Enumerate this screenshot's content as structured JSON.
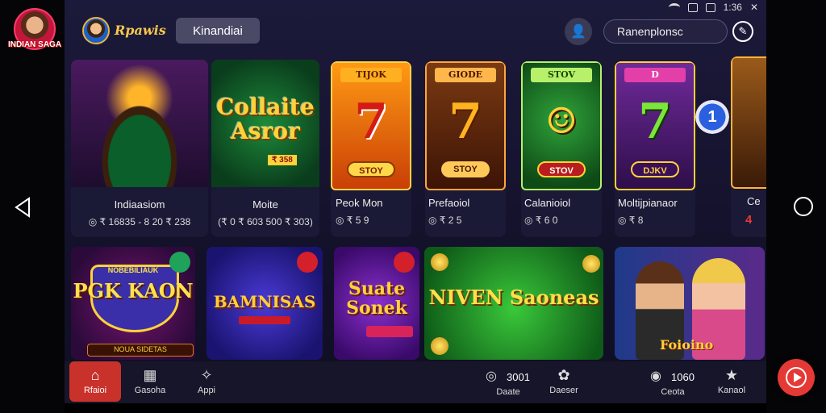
{
  "app": {
    "logo_caption": "INDIAN SAGA"
  },
  "status": {
    "time": "1:36"
  },
  "header": {
    "user_name": "Rpawis",
    "chip_label": "Kinandiai",
    "search_value": "Ranenplonsc"
  },
  "cards_row1": [
    {
      "title": "Indiaasiom",
      "meta": "◎ ₹ 16835 - 8 20 ₹ 238"
    },
    {
      "title": "Moite",
      "meta": "(₹ 0 ₹ 603 500 ₹ 303)",
      "logo": "Collaite Asror",
      "sub": "₹ 358"
    },
    {
      "title": "Peok Mon",
      "meta": "◎ ₹ 5 9",
      "tag": "TIJOK",
      "big": "7",
      "stop": "STOY"
    },
    {
      "title": "Prefaoiol",
      "meta": "◎ ₹ 2 5",
      "tag": "GIODE",
      "big": "7",
      "stop": "STOY"
    },
    {
      "title": "Calanioiol",
      "meta": "◎ ₹ 6 0",
      "tag": "STOV",
      "big": "☺",
      "stop": "STOV"
    },
    {
      "title": "Moltijpianaor",
      "meta": "◎ ₹ 8",
      "tag": "D",
      "big": "7",
      "stop": "DJKV"
    },
    {
      "title": "Ce",
      "meta": "4"
    }
  ],
  "badge_number": "1",
  "cards_row2": [
    {
      "logo_small": "NOBEBILIAUK",
      "logo": "PGK KAON",
      "bar": "NOUA SIDETAS"
    },
    {
      "logo": "BAMNISAS"
    },
    {
      "logo": "Suate Sonek"
    },
    {
      "logo": "NIVEN Saoneas"
    },
    {
      "logo": "Foioino"
    }
  ],
  "bottom_nav": {
    "home": "Rfaioi",
    "games": "Gasoha",
    "apps": "Appi",
    "date_value": "3001",
    "date_label": "Daate",
    "decor_label": "Daeser",
    "coins_value": "1060",
    "coins_label": "Ceota",
    "kanaol": "Kanaol"
  },
  "colors": {
    "accent": "#c9312b",
    "gold": "#ffd23a",
    "bg": "#1c1a3a"
  }
}
